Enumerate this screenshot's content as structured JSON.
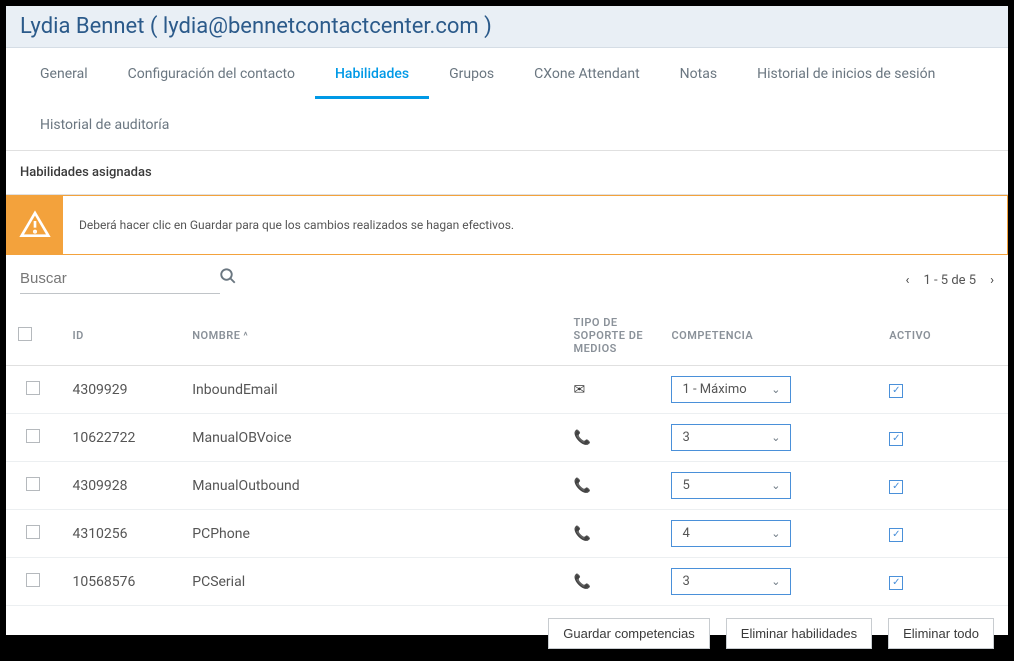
{
  "header": {
    "title": "Lydia Bennet ( lydia@bennetcontactcenter.com )"
  },
  "tabs": [
    {
      "label": "General",
      "active": false
    },
    {
      "label": "Configuración del contacto",
      "active": false
    },
    {
      "label": "Habilidades",
      "active": true
    },
    {
      "label": "Grupos",
      "active": false
    },
    {
      "label": "CXone Attendant",
      "active": false
    },
    {
      "label": "Notas",
      "active": false
    },
    {
      "label": "Historial de inicios de sesión",
      "active": false
    },
    {
      "label": "Historial de auditoría",
      "active": false
    }
  ],
  "section": {
    "title": "Habilidades asignadas"
  },
  "alert": {
    "text": "Deberá hacer clic en Guardar para que los cambios realizados se hagan efectivos."
  },
  "search": {
    "placeholder": "Buscar"
  },
  "pagination": {
    "text": "1 - 5 de 5"
  },
  "table": {
    "headers": {
      "id": "ID",
      "name": "Nombre",
      "media": "Tipo de soporte de medios",
      "proficiency": "Competencia",
      "active": "Activo"
    },
    "rows": [
      {
        "id": "4309929",
        "name": "InboundEmail",
        "media": "email",
        "proficiency": "1 - Máximo",
        "active": true
      },
      {
        "id": "10622722",
        "name": "ManualOBVoice",
        "media": "phone",
        "proficiency": "3",
        "active": true
      },
      {
        "id": "4309928",
        "name": "ManualOutbound",
        "media": "phone",
        "proficiency": "5",
        "active": true
      },
      {
        "id": "4310256",
        "name": "PCPhone",
        "media": "phone",
        "proficiency": "4",
        "active": true
      },
      {
        "id": "10568576",
        "name": "PCSerial",
        "media": "phone",
        "proficiency": "3",
        "active": true
      }
    ]
  },
  "buttons": {
    "save": "Guardar competencias",
    "remove": "Eliminar habilidades",
    "removeAll": "Eliminar todo"
  }
}
